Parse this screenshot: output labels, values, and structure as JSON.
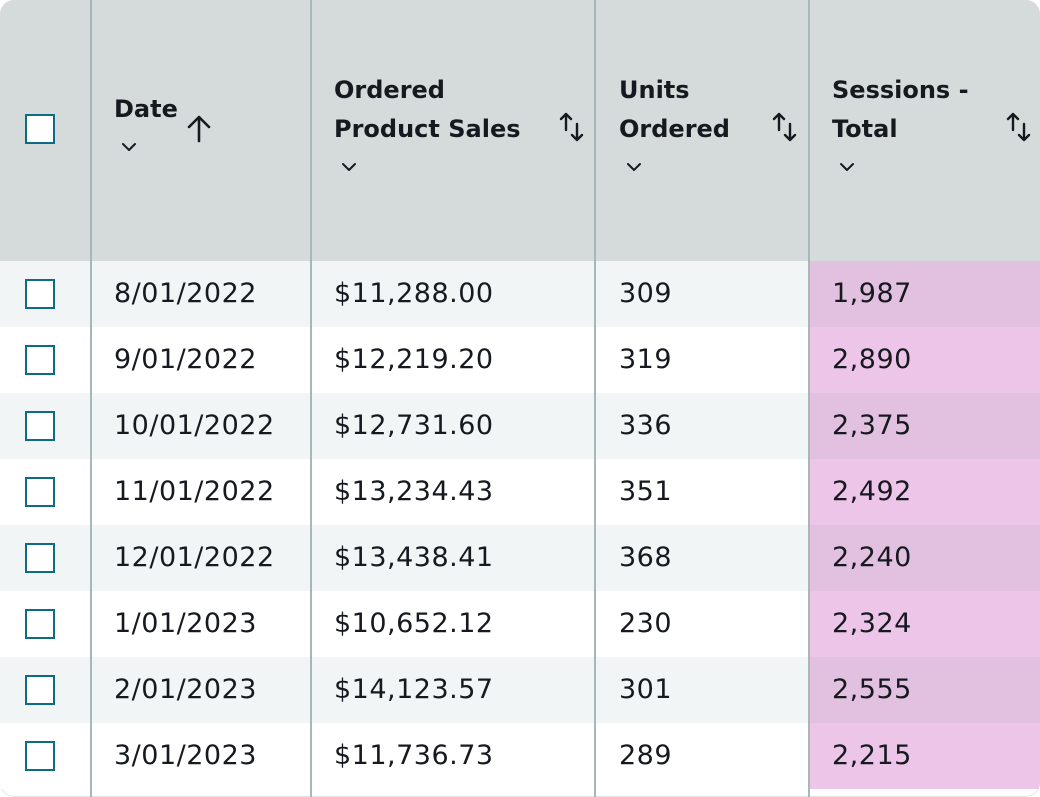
{
  "table": {
    "columns": [
      {
        "label_lines": [
          "Date"
        ],
        "sort": "ascending"
      },
      {
        "label_lines": [
          "Ordered",
          "Product Sales"
        ],
        "sort": "unsorted"
      },
      {
        "label_lines": [
          "Units",
          "Ordered"
        ],
        "sort": "unsorted"
      },
      {
        "label_lines": [
          "Sessions -",
          "Total"
        ],
        "sort": "unsorted"
      }
    ],
    "rows": [
      {
        "date": "8/01/2022",
        "sales": "$11,288.00",
        "units": "309",
        "sessions": "1,987"
      },
      {
        "date": "9/01/2022",
        "sales": "$12,219.20",
        "units": "319",
        "sessions": "2,890"
      },
      {
        "date": "10/01/2022",
        "sales": "$12,731.60",
        "units": "336",
        "sessions": "2,375"
      },
      {
        "date": "11/01/2022",
        "sales": "$13,234.43",
        "units": "351",
        "sessions": "2,492"
      },
      {
        "date": "12/01/2022",
        "sales": "$13,438.41",
        "units": "368",
        "sessions": "2,240"
      },
      {
        "date": "1/01/2023",
        "sales": "$10,652.12",
        "units": "230",
        "sessions": "2,324"
      },
      {
        "date": "2/01/2023",
        "sales": "$14,123.57",
        "units": "301",
        "sessions": "2,555"
      },
      {
        "date": "3/01/2023",
        "sales": "$11,736.73",
        "units": "289",
        "sessions": "2,215"
      }
    ]
  },
  "colors": {
    "header_bg": "#d5dbdb",
    "row_alt_bg": "#f2f5f5",
    "highlight_column_bg": "#ecc5e8",
    "checkbox_border": "#0d6b85",
    "divider": "#aab7b8",
    "text": "#16191f"
  },
  "icons": {
    "select_all": "checkbox-icon",
    "sort_ascending": "arrow-up-icon",
    "sort_unsorted": "sort-arrows-icon",
    "column_menu": "chevron-down-icon",
    "row_select": "checkbox-icon"
  }
}
